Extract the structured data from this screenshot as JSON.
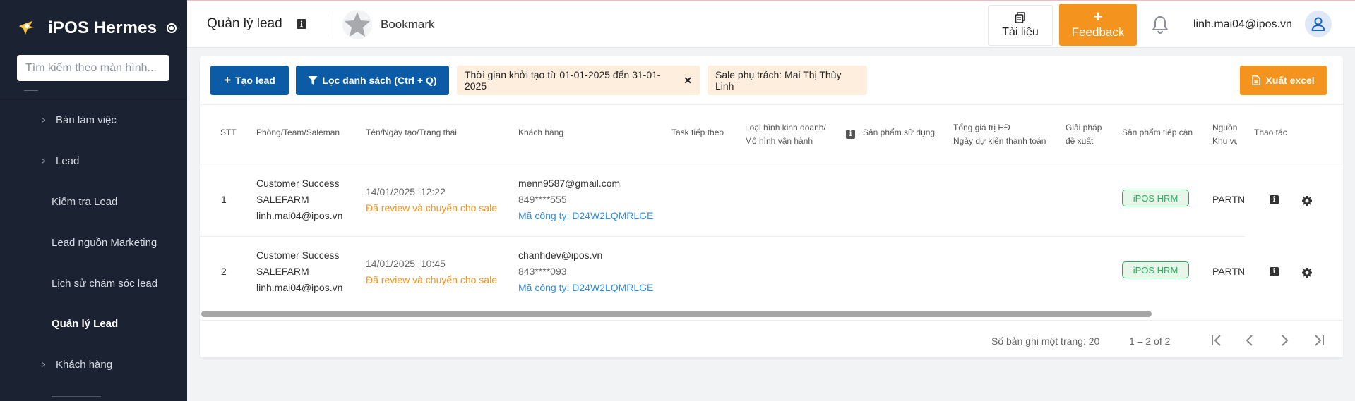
{
  "sidebar": {
    "brand": "iPOS Hermes",
    "search_placeholder": "Tìm kiếm theo màn hình...",
    "items": [
      {
        "label": "Bàn làm việc",
        "expandable": true
      },
      {
        "label": "Lead",
        "expandable": true
      },
      {
        "label": "Kiểm tra Lead",
        "expandable": false
      },
      {
        "label": "Lead nguồn Marketing",
        "expandable": false
      },
      {
        "label": "Lịch sử chăm sóc lead",
        "expandable": false
      },
      {
        "label": "Quản lý Lead",
        "expandable": false,
        "active": true
      },
      {
        "label": "Khách hàng",
        "expandable": true
      }
    ]
  },
  "header": {
    "title": "Quản lý lead",
    "bookmark": "Bookmark",
    "docs_label": "Tài liệu",
    "feedback_label": "Feedback",
    "user_email": "linh.mai04@ipos.vn"
  },
  "toolbar": {
    "create_label": "Tạo lead",
    "filter_label": "Lọc danh sách (Ctrl + Q)",
    "chip_time": "Thời gian khởi tạo từ 01-01-2025 đến 31-01-2025",
    "chip_sale": "Sale phụ trách: Mai Thị Thùy Linh",
    "export_label": "Xuất excel"
  },
  "table": {
    "columns": {
      "stt": "STT",
      "team": "Phòng/Team/Saleman",
      "name": "Tên/Ngày tạo/Trạng thái",
      "customer": "Khách hàng",
      "task": "Task tiếp theo",
      "business_1": "Loại hình kinh doanh/",
      "business_2": "Mô hình vận hành",
      "product_used": "Sản phẩm sử dụng",
      "value_1": "Tổng giá trị HĐ",
      "value_2": "Ngày dự kiến thanh toán",
      "solution_1": "Giải pháp",
      "solution_2": "đề xuất",
      "approach": "Sản phẩm tiếp cận",
      "source_1": "Nguồn tạ",
      "source_2": "Khu vực",
      "actions": "Thao tác"
    },
    "rows": [
      {
        "stt": "1",
        "team_1": "Customer Success",
        "team_2": "SALEFARM",
        "team_3": "linh.mai04@ipos.vn",
        "date": "14/01/2025  12:22",
        "status": "Đã review và chuyển cho sale",
        "email": "menn9587@gmail.com",
        "phone": "849****555",
        "company": "Mã công ty: D24W2LQMRLGE",
        "product": "iPOS HRM",
        "source": "PARTN"
      },
      {
        "stt": "2",
        "team_1": "Customer Success",
        "team_2": "SALEFARM",
        "team_3": "linh.mai04@ipos.vn",
        "date": "14/01/2025  10:45",
        "status": "Đã review và chuyển cho sale",
        "email": "chanhdev@ipos.vn",
        "phone": "843****093",
        "company": "Mã công ty: D24W2LQMRLGE",
        "product": "iPOS HRM",
        "source": "PARTN"
      }
    ]
  },
  "pagination": {
    "page_size_label": "Số bản ghi một trang: 20",
    "range": "1 – 2 of 2"
  },
  "colors": {
    "sidebar_bg": "#1b2231",
    "primary": "#0c5ba7",
    "accent": "#f4941e",
    "chip_bg": "#fdeedd",
    "badge_green": "#27ae5c",
    "link": "#2d8ee6"
  }
}
